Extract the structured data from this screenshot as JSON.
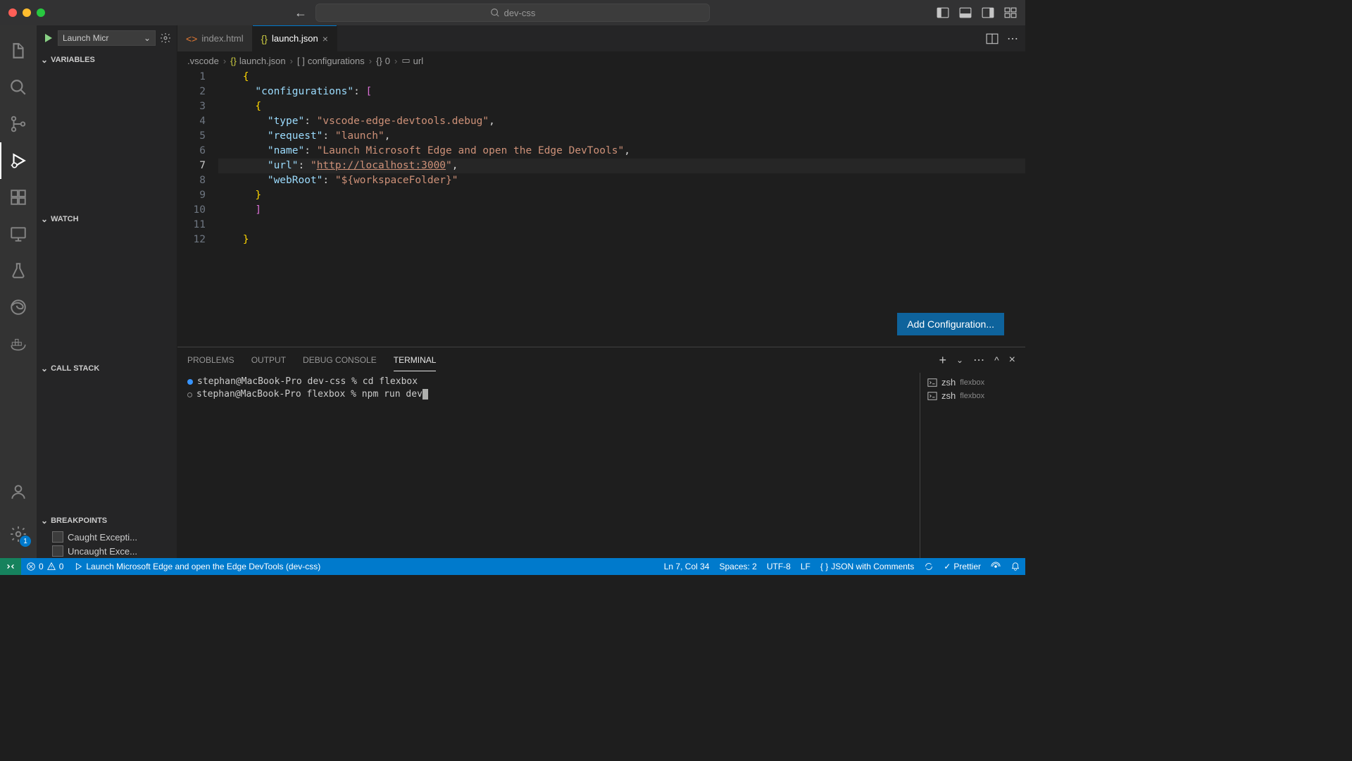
{
  "titlebar": {
    "search_text": "dev-css"
  },
  "sidebar": {
    "launch_label": "Launch Micr",
    "sections": {
      "variables": "VARIABLES",
      "watch": "WATCH",
      "callstack": "CALL STACK",
      "breakpoints": "BREAKPOINTS"
    },
    "breakpoints": [
      "Caught Excepti...",
      "Uncaught Exce..."
    ]
  },
  "tabs": [
    {
      "label": "index.html",
      "icon": "html",
      "active": false
    },
    {
      "label": "launch.json",
      "icon": "json",
      "active": true
    }
  ],
  "breadcrumb": [
    ".vscode",
    "launch.json",
    "configurations",
    "0",
    "url"
  ],
  "code": {
    "lines": [
      {
        "n": 1,
        "html": "<span class='tok-brace'>{</span>"
      },
      {
        "n": 2,
        "html": "  <span class='tok-key'>\"configurations\"</span><span class='tok-punc'>: </span><span class='tok-brack'>[</span>"
      },
      {
        "n": 3,
        "html": "  <span class='tok-brace'>{</span>"
      },
      {
        "n": 4,
        "html": "    <span class='tok-key'>\"type\"</span><span class='tok-punc'>: </span><span class='tok-str'>\"vscode-edge-devtools.debug\"</span><span class='tok-punc'>,</span>"
      },
      {
        "n": 5,
        "html": "    <span class='tok-key'>\"request\"</span><span class='tok-punc'>: </span><span class='tok-str'>\"launch\"</span><span class='tok-punc'>,</span>"
      },
      {
        "n": 6,
        "html": "    <span class='tok-key'>\"name\"</span><span class='tok-punc'>: </span><span class='tok-str'>\"Launch Microsoft Edge and open the Edge DevTools\"</span><span class='tok-punc'>,</span>"
      },
      {
        "n": 7,
        "html": "    <span class='tok-key'>\"url\"</span><span class='tok-punc'>: </span><span class='tok-str'>\"</span><span class='tok-url'>http://localhost:3000</span><span class='tok-str'>\"</span><span class='tok-punc'>,</span>"
      },
      {
        "n": 8,
        "html": "    <span class='tok-key'>\"webRoot\"</span><span class='tok-punc'>: </span><span class='tok-str'>\"${workspaceFolder}\"</span>"
      },
      {
        "n": 9,
        "html": "  <span class='tok-brace'>}</span>"
      },
      {
        "n": 10,
        "html": "  <span class='tok-brack'>]</span>"
      },
      {
        "n": 11,
        "html": ""
      },
      {
        "n": 12,
        "html": "<span class='tok-brace'>}</span>"
      }
    ],
    "highlight_line": 7,
    "add_config_label": "Add Configuration..."
  },
  "panel": {
    "tabs": [
      "PROBLEMS",
      "OUTPUT",
      "DEBUG CONSOLE",
      "TERMINAL"
    ],
    "active_tab": "TERMINAL",
    "terminal": {
      "lines": [
        {
          "dot": "blue",
          "text": "stephan@MacBook-Pro dev-css % cd flexbox"
        },
        {
          "dot": "grey",
          "text": "stephan@MacBook-Pro flexbox % npm run dev",
          "cursor": true
        }
      ],
      "shells": [
        {
          "name": "zsh",
          "sub": "flexbox"
        },
        {
          "name": "zsh",
          "sub": "flexbox"
        }
      ]
    }
  },
  "statusbar": {
    "errors": "0",
    "warnings": "0",
    "debug_target": "Launch Microsoft Edge and open the Edge DevTools (dev-css)",
    "cursor": "Ln 7, Col 34",
    "spaces": "Spaces: 2",
    "encoding": "UTF-8",
    "eol": "LF",
    "lang": "JSON with Comments",
    "prettier": "Prettier"
  },
  "activity_badge": "1"
}
